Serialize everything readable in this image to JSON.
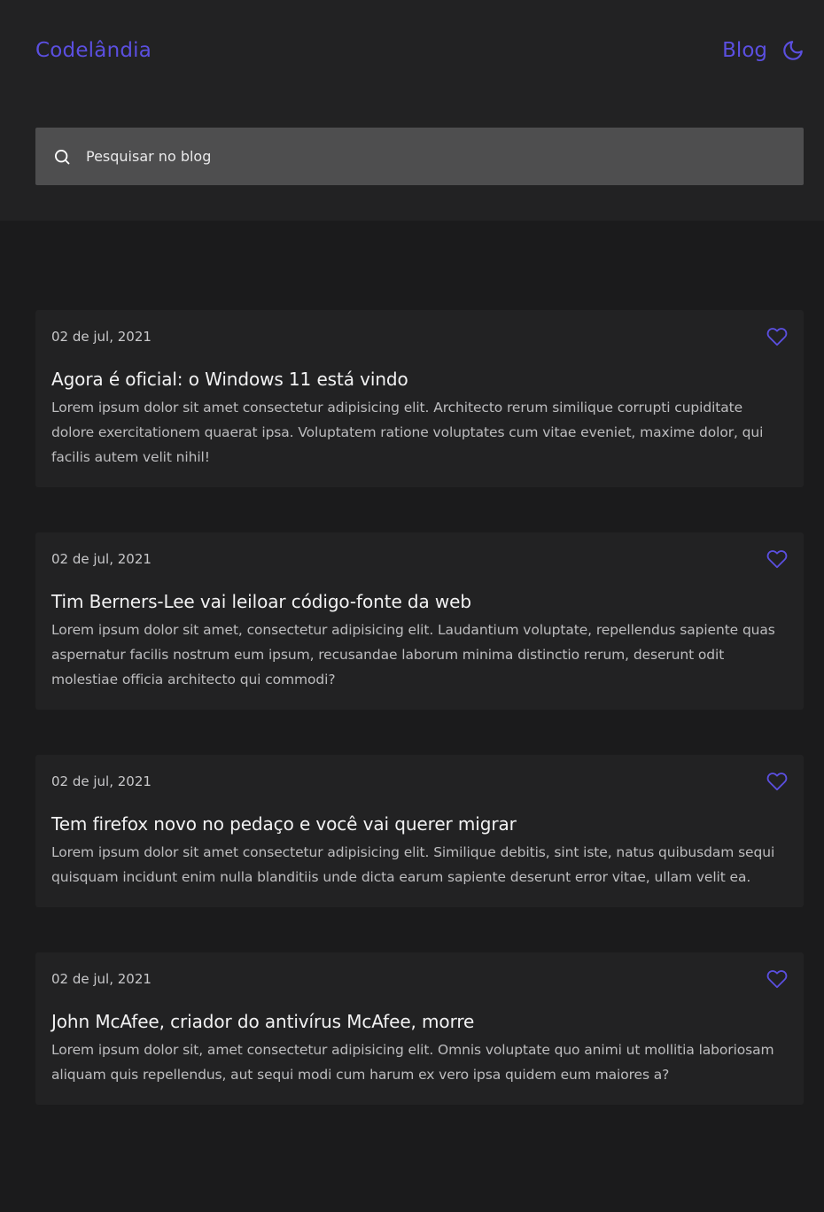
{
  "header": {
    "logo": "Codelândia",
    "nav_blog": "Blog",
    "theme_toggle_icon": "moon-icon"
  },
  "search": {
    "placeholder": "Pesquisar no blog",
    "value": "",
    "icon": "search-icon"
  },
  "colors": {
    "accent": "#5b4fe0",
    "background": "#1b1b1c",
    "card": "#222223",
    "search_bg": "#4e4e4f"
  },
  "posts": [
    {
      "date": "02 de jul, 2021",
      "title": "Agora é oficial: o Windows 11 está vindo",
      "excerpt": "Lorem ipsum dolor sit amet consectetur adipisicing elit. Architecto rerum similique corrupti cupiditate dolore exercitationem quaerat ipsa. Voluptatem ratione voluptates cum vitae eveniet, maxime dolor, qui facilis autem velit nihil!",
      "like_icon": "heart-icon"
    },
    {
      "date": "02 de jul, 2021",
      "title": "Tim Berners-Lee vai leiloar código-fonte da web",
      "excerpt": "Lorem ipsum dolor sit amet, consectetur adipisicing elit. Laudantium voluptate, repellendus sapiente quas aspernatur facilis nostrum eum ipsum, recusandae laborum minima distinctio rerum, deserunt odit molestiae officia architecto qui commodi?",
      "like_icon": "heart-icon"
    },
    {
      "date": "02 de jul, 2021",
      "title": "Tem firefox novo no pedaço e você vai querer migrar",
      "excerpt": "Lorem ipsum dolor sit amet consectetur adipisicing elit. Similique debitis, sint iste, natus quibusdam sequi quisquam incidunt enim nulla blanditiis unde dicta earum sapiente deserunt error vitae, ullam velit ea.",
      "like_icon": "heart-icon"
    },
    {
      "date": "02 de jul, 2021",
      "title": "John McAfee, criador do antivírus McAfee, morre",
      "excerpt": "Lorem ipsum dolor sit, amet consectetur adipisicing elit. Omnis voluptate quo animi ut mollitia laboriosam aliquam quis repellendus, aut sequi modi cum harum ex vero ipsa quidem eum maiores a?",
      "like_icon": "heart-icon"
    }
  ]
}
